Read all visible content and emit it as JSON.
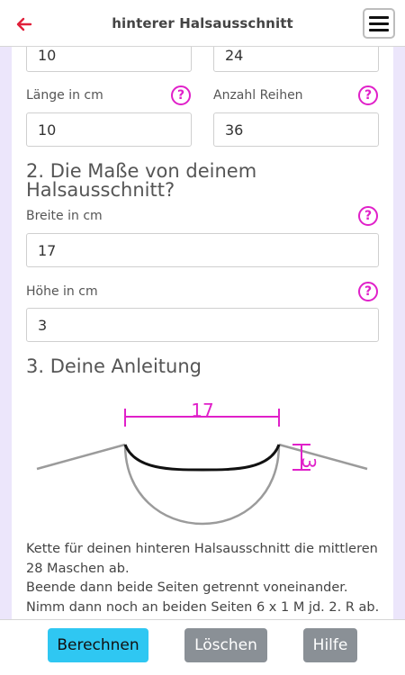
{
  "header": {
    "title": "hinterer Halsausschnitt"
  },
  "form": {
    "row1": {
      "left_value": "10",
      "right_value": "24"
    },
    "laenge": {
      "label": "Länge in cm",
      "value": "10",
      "help": "?"
    },
    "reihen": {
      "label": "Anzahl Reihen",
      "value": "36",
      "help": "?"
    },
    "section2": {
      "title": "2. Die Maße von deinem Halsausschnitt?"
    },
    "breite": {
      "label": "Breite in cm",
      "value": "17",
      "help": "?"
    },
    "hoehe": {
      "label": "Höhe in cm",
      "value": "3",
      "help": "?"
    },
    "section3": {
      "title": "3. Deine Anleitung"
    }
  },
  "diagram": {
    "width_label": "17",
    "height_label": "3",
    "accent_color": "#e020c9"
  },
  "instructions": {
    "line1": "Kette für deinen hinteren Halsausschnitt die mittleren 28 Maschen ab.",
    "line2": "Beende dann beide Seiten getrennt voneinander.",
    "line3": "Nimm dann noch an beiden Seiten 6 x 1 M jd. 2. R ab."
  },
  "buttons": {
    "calculate": "Berechnen",
    "clear": "Löschen",
    "help": "Hilfe"
  },
  "icons": {
    "back": "arrow-left-icon",
    "menu": "hamburger-menu-icon",
    "help": "question-circle-icon"
  }
}
